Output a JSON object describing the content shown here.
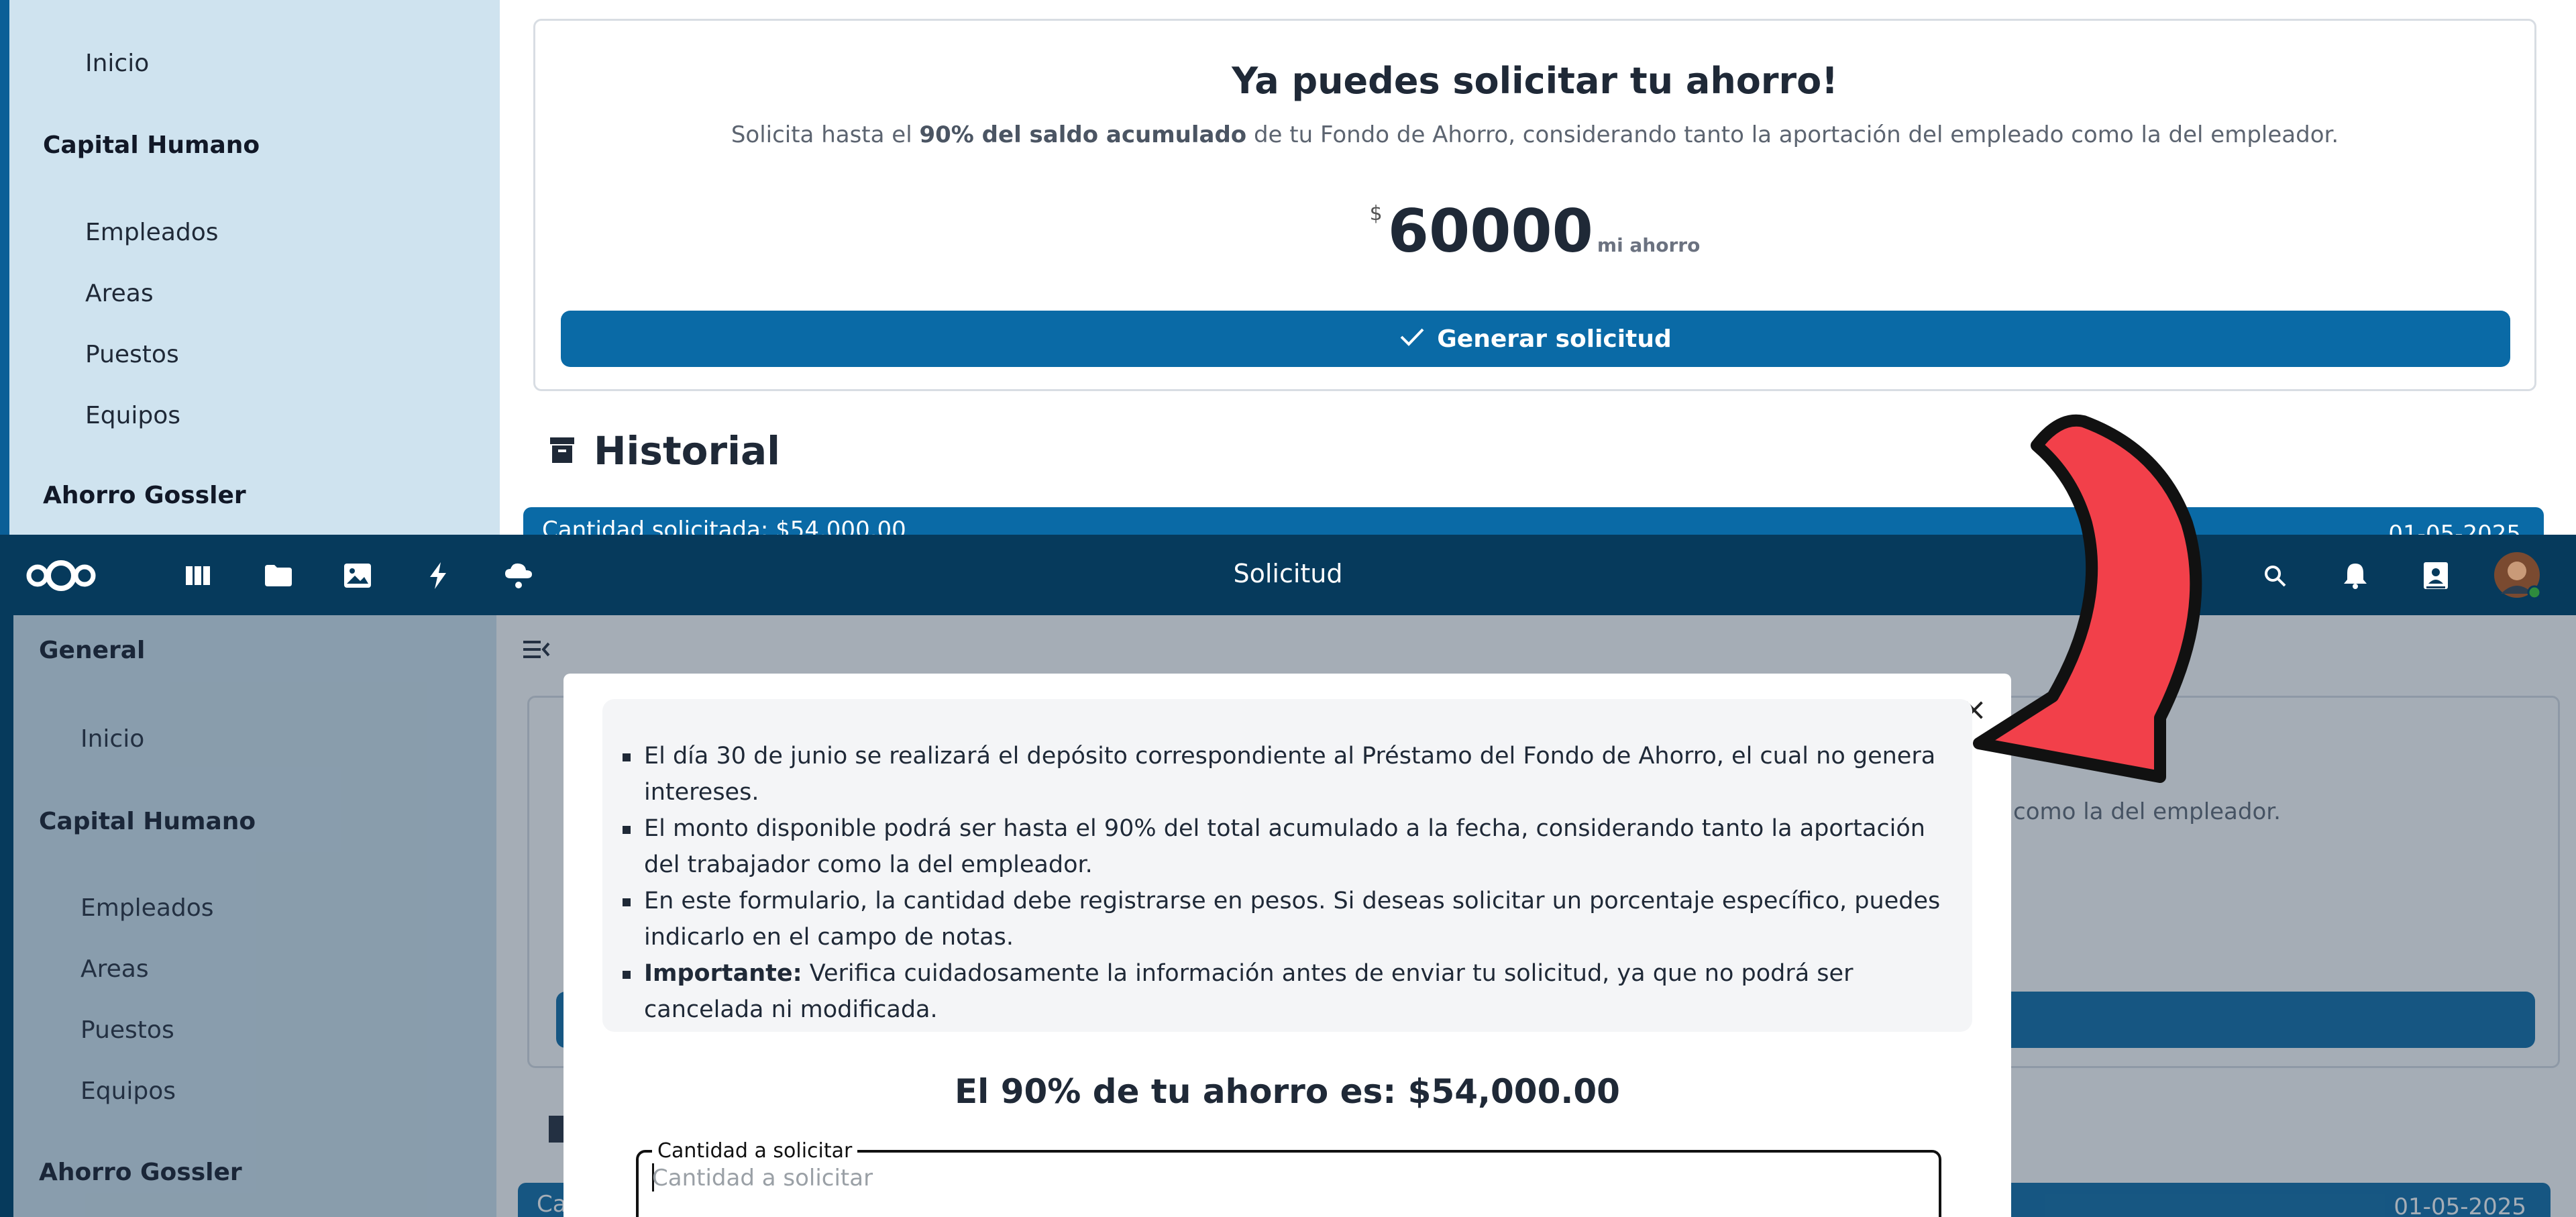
{
  "top": {
    "sidebar": {
      "inicio": "Inicio",
      "capital_humano": "Capital Humano",
      "items": [
        "Empleados",
        "Areas",
        "Puestos",
        "Equipos"
      ],
      "ahorro": "Ahorro Gossler"
    },
    "card": {
      "title": "Ya puedes solicitar tu ahorro!",
      "sub_pre": "Solicita hasta el ",
      "sub_bold": "90% del saldo acumulado",
      "sub_post": " de tu Fondo de Ahorro, considerando tanto la aportación del empleado como la del empleador.",
      "currency": "$",
      "amount": "60000",
      "amount_label": "mi ahorro",
      "button": "Generar solicitud"
    },
    "historial": {
      "title": "Historial",
      "bar_left": "Cantidad solicitada: $54,000.00",
      "bar_right": "01-05-2025"
    }
  },
  "bottom": {
    "topbar": {
      "title": "Solicitud"
    },
    "sidebar": {
      "general": "General",
      "inicio": "Inicio",
      "capital_humano": "Capital Humano",
      "items": [
        "Empleados",
        "Areas",
        "Puestos",
        "Equipos"
      ],
      "ahorro": "Ahorro Gossler"
    },
    "bg_sub": "como la del empleador.",
    "bg_bar_left": "Ca",
    "bg_bar_right": "01-05-2025",
    "modal": {
      "notice": [
        {
          "bold": "",
          "text": "El día 30 de junio se realizará el depósito correspondiente al Préstamo del Fondo de Ahorro, el cual no genera intereses."
        },
        {
          "bold": "",
          "text": "El monto disponible podrá ser hasta el 90% del total acumulado a la fecha, considerando tanto la aportación del trabajador como la del empleador."
        },
        {
          "bold": "",
          "text": "En este formulario, la cantidad debe registrarse en pesos. Si deseas solicitar un porcentaje específico, puedes indicarlo en el campo de notas."
        },
        {
          "bold": "Importante:",
          "text": " Verifica cuidadosamente la información antes de enviar tu solicitud, ya que no podrá ser cancelada ni modificada."
        }
      ],
      "heading": "El 90% de tu ahorro es: $54,000.00",
      "field_label": "Cantidad a solicitar",
      "field_placeholder": "Cantidad a solicitar",
      "close": "×"
    }
  },
  "colors": {
    "primary": "#0a6aa6",
    "header": "#063a5c",
    "sidebar": "#cfe3ef",
    "arrow": "#f2404a"
  },
  "icons": [
    "nextcloud-logo-icon",
    "dashboard-icon",
    "files-icon",
    "photos-icon",
    "activity-icon",
    "weather-icon",
    "search-icon",
    "bell-icon",
    "contacts-icon",
    "avatar",
    "archive-icon",
    "check-icon",
    "close-icon",
    "menu-toggle-icon",
    "red-arrow-icon"
  ]
}
